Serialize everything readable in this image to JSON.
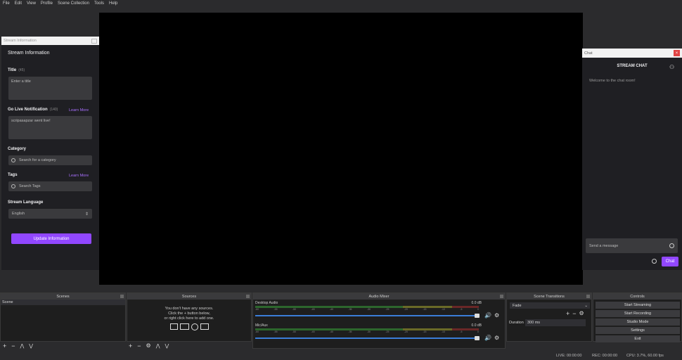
{
  "menu": [
    "File",
    "Edit",
    "View",
    "Profile",
    "Scene Collection",
    "Tools",
    "Help"
  ],
  "stream_info": {
    "dock_title": "Stream Information",
    "heading": "Stream Information",
    "title_label": "Title",
    "title_count": "(45)",
    "title_placeholder": "Enter a title",
    "notification_label": "Go Live Notification",
    "notification_count": "(140)",
    "notification_link": "Learn More",
    "notification_value": "scripasapzar went live!",
    "category_label": "Category",
    "category_placeholder": "Search for a category",
    "tags_label": "Tags",
    "tags_link": "Learn More",
    "tags_placeholder": "Search Tags",
    "language_label": "Stream Language",
    "language_value": "English",
    "update_button": "Update Information"
  },
  "chat": {
    "dock_title": "Chat",
    "close_glyph": "×",
    "header": "STREAM CHAT",
    "welcome": "Welcome to the chat room!",
    "input_placeholder": "Send a message",
    "chat_button": "Chat"
  },
  "scenes": {
    "title": "Scenes",
    "items": [
      "Scene"
    ]
  },
  "sources": {
    "title": "Sources",
    "empty_line1": "You don't have any sources.",
    "empty_line2": "Click the + button below,",
    "empty_line3": "or right click here to add one."
  },
  "mixer": {
    "title": "Audio Mixer",
    "channels": [
      {
        "name": "Desktop Audio",
        "db": "0.0 dB",
        "level": 0.0
      },
      {
        "name": "Mic/Aux",
        "db": "0.0 dB",
        "level": 0.3
      }
    ],
    "ticks": [
      "-60",
      "-55",
      "-50",
      "-45",
      "-40",
      "-35",
      "-30",
      "-25",
      "-20",
      "-15",
      "-10",
      "-5",
      "0"
    ]
  },
  "transitions": {
    "title": "Scene Transitions",
    "type": "Fade",
    "duration_label": "Duration",
    "duration_value": "300 ms"
  },
  "controls": {
    "title": "Controls",
    "buttons": [
      "Start Streaming",
      "Start Recording",
      "Studio Mode",
      "Settings",
      "Exit"
    ]
  },
  "status": {
    "live": "LIVE: 00:00:00",
    "rec": "REC: 00:00:00",
    "cpu": "CPU: 3.7%, 60.00 fps"
  },
  "colors": {
    "accent": "#9147ff",
    "meter_green": "#3fbf3f",
    "meter_yellow": "#c8c832",
    "meter_red": "#c83232",
    "meter_blue": "#3b7dd8"
  }
}
